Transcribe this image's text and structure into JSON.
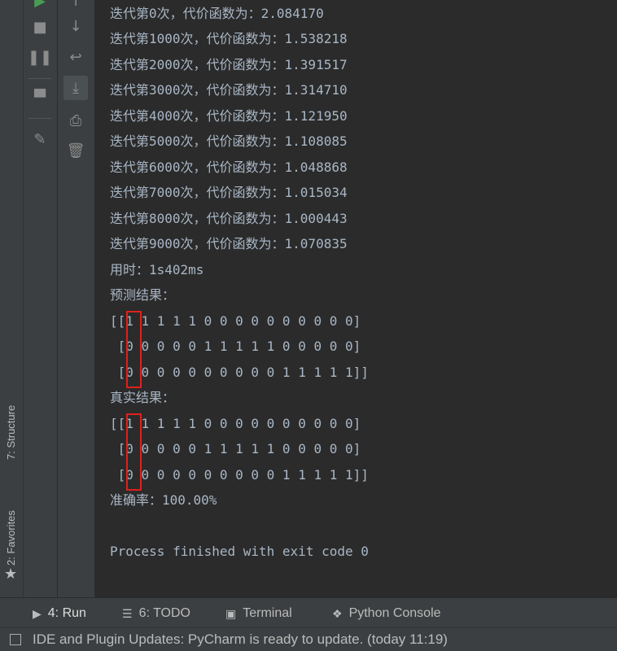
{
  "console": {
    "lines": [
      "迭代第0次，代价函数为：2.084170",
      "迭代第1000次，代价函数为：1.538218",
      "迭代第2000次，代价函数为：1.391517",
      "迭代第3000次，代价函数为：1.314710",
      "迭代第4000次，代价函数为：1.121950",
      "迭代第5000次，代价函数为：1.108085",
      "迭代第6000次，代价函数为：1.048868",
      "迭代第7000次，代价函数为：1.015034",
      "迭代第8000次，代价函数为：1.000443",
      "迭代第9000次，代价函数为：1.070835",
      "用时：1s402ms",
      "预测结果：",
      "[[1 1 1 1 1 0 0 0 0 0 0 0 0 0 0]",
      " [0 0 0 0 0 1 1 1 1 1 0 0 0 0 0]",
      " [0 0 0 0 0 0 0 0 0 0 1 1 1 1 1]]",
      "真实结果：",
      "[[1 1 1 1 1 0 0 0 0 0 0 0 0 0 0]",
      " [0 0 0 0 0 1 1 1 1 1 0 0 0 0 0]",
      " [0 0 0 0 0 0 0 0 0 0 1 1 1 1 1]]",
      "准确率：100.00%",
      "",
      "Process finished with exit code 0"
    ]
  },
  "side_tabs": {
    "structure": "7: Structure",
    "favorites": "2: Favorites"
  },
  "bottom_tabs": {
    "run": "4: Run",
    "todo": "6: TODO",
    "terminal": "Terminal",
    "python_console": "Python Console"
  },
  "status_bar": {
    "message": "IDE and Plugin Updates: PyCharm is ready to update. (today 11:19)"
  },
  "colors": {
    "highlight_box": "#e0201b",
    "console_text": "#a9b7c6",
    "background": "#2b2b2b"
  }
}
